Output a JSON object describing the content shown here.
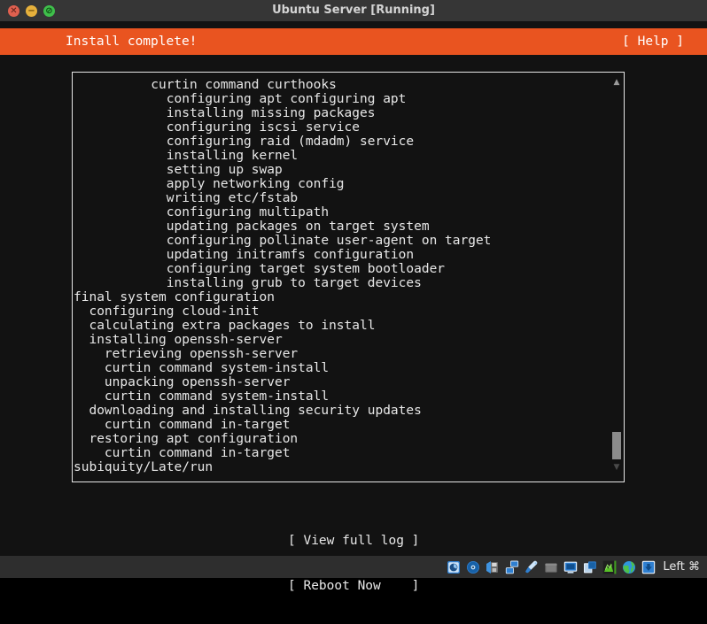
{
  "window": {
    "title": "Ubuntu Server [Running]",
    "traffic_lights": [
      {
        "name": "close",
        "glyph": "✕",
        "color": "#e0604f"
      },
      {
        "name": "minimize",
        "glyph": "−",
        "color": "#e6b13c"
      },
      {
        "name": "maximize",
        "glyph": "⊘",
        "color": "#3fbf4b"
      }
    ]
  },
  "header": {
    "title": "Install complete!",
    "help_label": "[ Help ]",
    "background": "#e95420",
    "foreground": "#ffffff"
  },
  "log": {
    "lines": [
      "          curtin command curthooks",
      "            configuring apt configuring apt",
      "            installing missing packages",
      "            configuring iscsi service",
      "            configuring raid (mdadm) service",
      "            installing kernel",
      "            setting up swap",
      "            apply networking config",
      "            writing etc/fstab",
      "            configuring multipath",
      "            updating packages on target system",
      "            configuring pollinate user-agent on target",
      "            updating initramfs configuration",
      "            configuring target system bootloader",
      "            installing grub to target devices",
      "final system configuration",
      "  configuring cloud-init",
      "  calculating extra packages to install",
      "  installing openssh-server",
      "    retrieving openssh-server",
      "    curtin command system-install",
      "    unpacking openssh-server",
      "    curtin command system-install",
      "  downloading and installing security updates",
      "    curtin command in-target",
      "  restoring apt configuration",
      "    curtin command in-target",
      "subiquity/Late/run"
    ],
    "scrollbar": {
      "up_arrow": "▲",
      "down_arrow": "▼"
    }
  },
  "actions": {
    "view_full_log": "[ View full log ]",
    "reboot_now": "[ Reboot Now    ]"
  },
  "statusbar": {
    "icons": [
      "hard-disk-icon",
      "optical-disc-icon",
      "floppy-disk-icon",
      "network-icon",
      "usb-icon",
      "shared-folder-icon",
      "display-icon",
      "video-capture-icon",
      "recording-icon",
      "globe-icon",
      "host-key-icon"
    ],
    "host_key": "Left ⌘"
  }
}
